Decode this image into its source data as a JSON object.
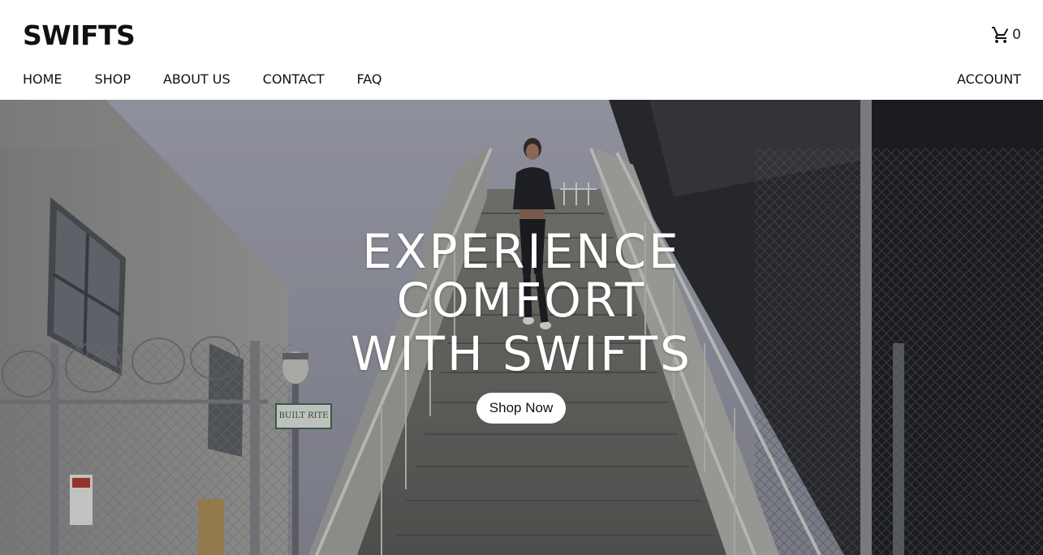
{
  "brand": {
    "logo_text": "SWIFTS"
  },
  "cart": {
    "icon": "shopping-cart-icon",
    "count": "0"
  },
  "nav": {
    "items": [
      {
        "label": "HOME"
      },
      {
        "label": "SHOP"
      },
      {
        "label": "ABOUT US"
      },
      {
        "label": "CONTACT"
      },
      {
        "label": "FAQ"
      }
    ],
    "account_label": "ACCOUNT"
  },
  "hero": {
    "headline_line1": "EXPERIENCE",
    "headline_line2": "COMFORT",
    "headline_line3": "WITH SWIFTS",
    "cta_label": "Shop Now",
    "sign_text": "BUILT RITE"
  },
  "colors": {
    "text": "#111111",
    "header_bg": "#ffffff",
    "hero_text": "#ffffff",
    "cta_bg": "#ffffff"
  }
}
